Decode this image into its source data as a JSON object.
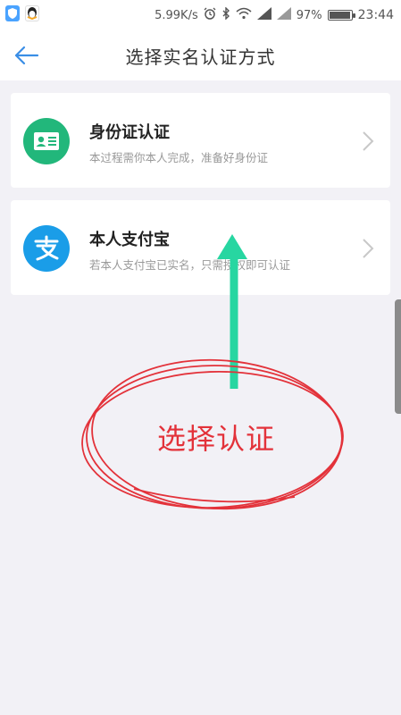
{
  "status_bar": {
    "network_speed": "5.99K/s",
    "battery_percent": "97%",
    "time": "23:44",
    "icons": [
      "alarm-icon",
      "bluetooth-icon",
      "wifi-icon",
      "signal-icon",
      "battery-icon"
    ]
  },
  "nav": {
    "title": "选择实名认证方式",
    "back_icon": "arrow-left-icon"
  },
  "options": [
    {
      "title": "身份证认证",
      "subtitle": "本过程需你本人完成，准备好身份证",
      "icon": "id-card-icon",
      "icon_color": "#22b77b"
    },
    {
      "title": "本人支付宝",
      "subtitle": "若本人支付宝已实名，只需授权即可认证",
      "icon": "alipay-icon",
      "icon_color": "#1a9de8"
    }
  ],
  "annotation": {
    "text": "选择认证",
    "arrow_color": "#27d6a1",
    "circle_color": "#e3323a"
  },
  "colors": {
    "background": "#f2f1f6",
    "accent": "#3a8ee6"
  }
}
